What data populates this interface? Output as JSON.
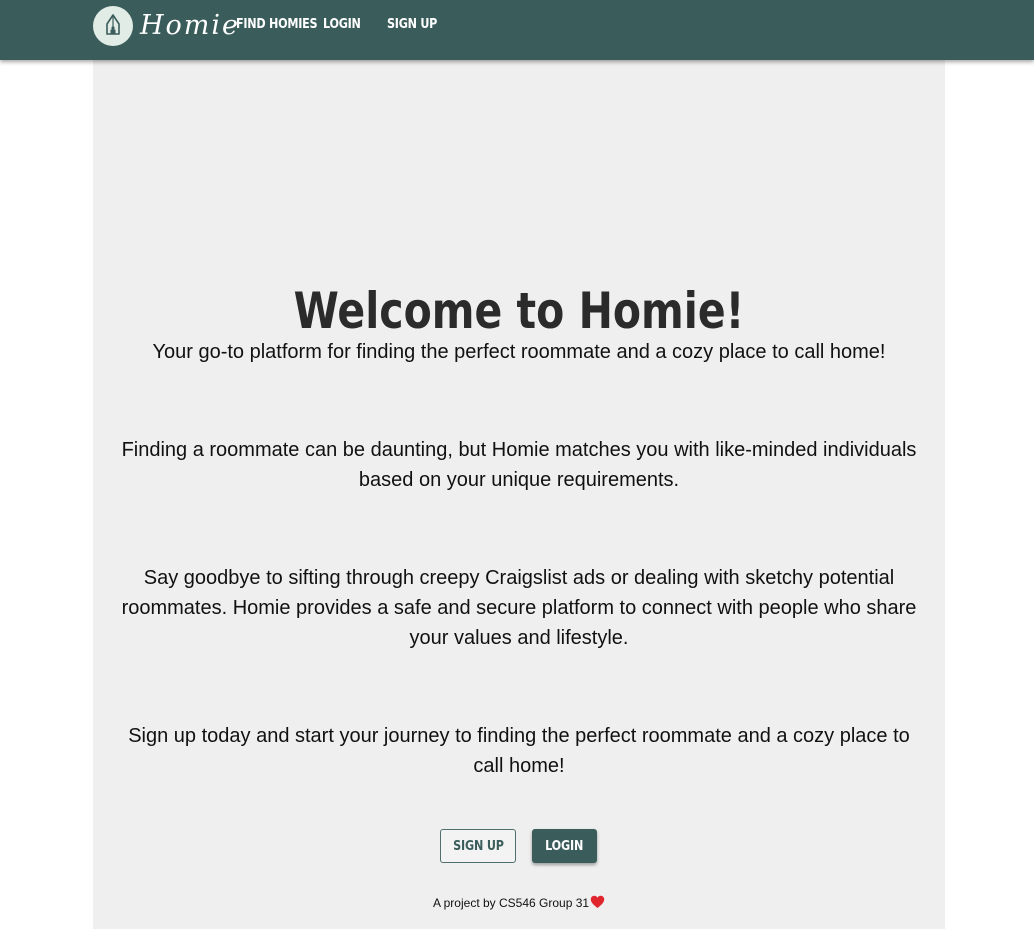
{
  "nav": {
    "brand": "Homie",
    "logo_icon": "house-pen-logo-icon",
    "links": [
      "FIND HOMIES",
      "LOGIN",
      "SIGN UP"
    ]
  },
  "main": {
    "title": "Welcome to Homie!",
    "paragraphs": [
      "Your go-to platform for finding the perfect roommate and a cozy place to call home!",
      "Finding a roommate can be daunting, but Homie matches you with like-minded individuals based on your unique requirements.",
      "Say goodbye to sifting through creepy Craigslist ads or dealing with sketchy potential roommates. Homie provides a safe and secure platform to connect with people who share your values and lifestyle.",
      "Sign up today and start your journey to finding the perfect roommate and a cozy place to call home!"
    ],
    "buttons": {
      "signup": "SIGN UP",
      "login": "LOGIN"
    },
    "footer": "A project by CS546 Group 31",
    "footer_icon": "heart-icon"
  },
  "colors": {
    "primary": "#3a5d5b",
    "panel": "#efefef",
    "heart": "#e0252d"
  }
}
